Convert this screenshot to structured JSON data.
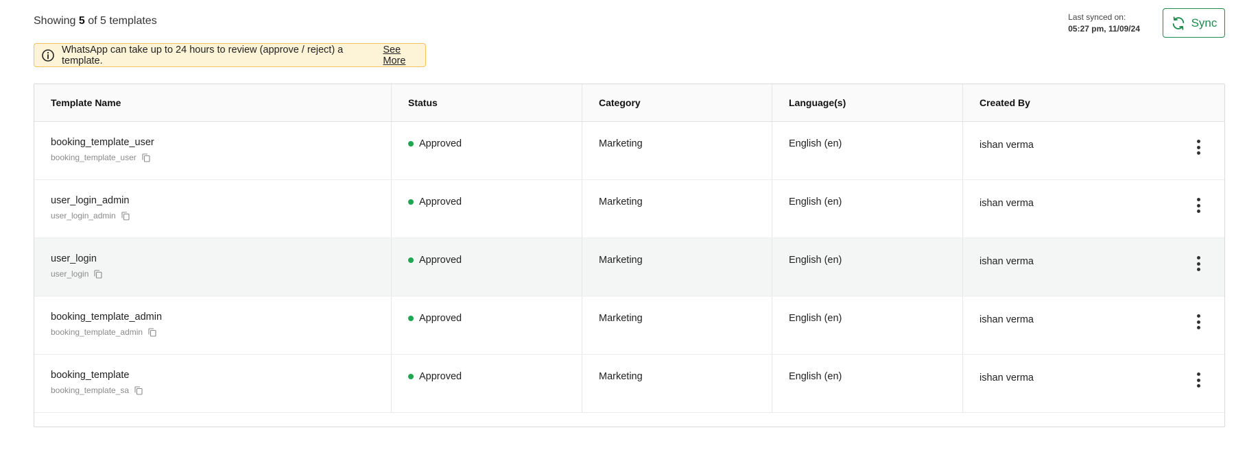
{
  "header": {
    "showing_prefix": "Showing",
    "showing_count": "5",
    "showing_suffix": "of 5 templates"
  },
  "sync": {
    "label": "Last synced on:",
    "timestamp": "05:27 pm, 11/09/24",
    "button_label": "Sync",
    "icon": "refresh-icon",
    "accent_color": "#1e8a4c"
  },
  "alert": {
    "icon": "info-icon",
    "text": "WhatsApp can take up to 24 hours to review (approve / reject) a template.",
    "link_label": "See More"
  },
  "table": {
    "columns": [
      "Template Name",
      "Status",
      "Category",
      "Language(s)",
      "Created By"
    ],
    "rows": [
      {
        "name": "booking_template_user",
        "sub": "booking_template_user",
        "status": "Approved",
        "category": "Marketing",
        "language": "English (en)",
        "created_by": "ishan verma"
      },
      {
        "name": "user_login_admin",
        "sub": "user_login_admin",
        "status": "Approved",
        "category": "Marketing",
        "language": "English (en)",
        "created_by": "ishan verma"
      },
      {
        "name": "user_login",
        "sub": "user_login",
        "status": "Approved",
        "category": "Marketing",
        "language": "English (en)",
        "created_by": "ishan verma"
      },
      {
        "name": "booking_template_admin",
        "sub": "booking_template_admin",
        "status": "Approved",
        "category": "Marketing",
        "language": "English (en)",
        "created_by": "ishan verma"
      },
      {
        "name": "booking_template",
        "sub": "booking_template_sa",
        "status": "Approved",
        "category": "Marketing",
        "language": "English (en)",
        "created_by": "ishan verma"
      }
    ],
    "status_color": "#1fa653",
    "highlight_row_index": 2
  }
}
